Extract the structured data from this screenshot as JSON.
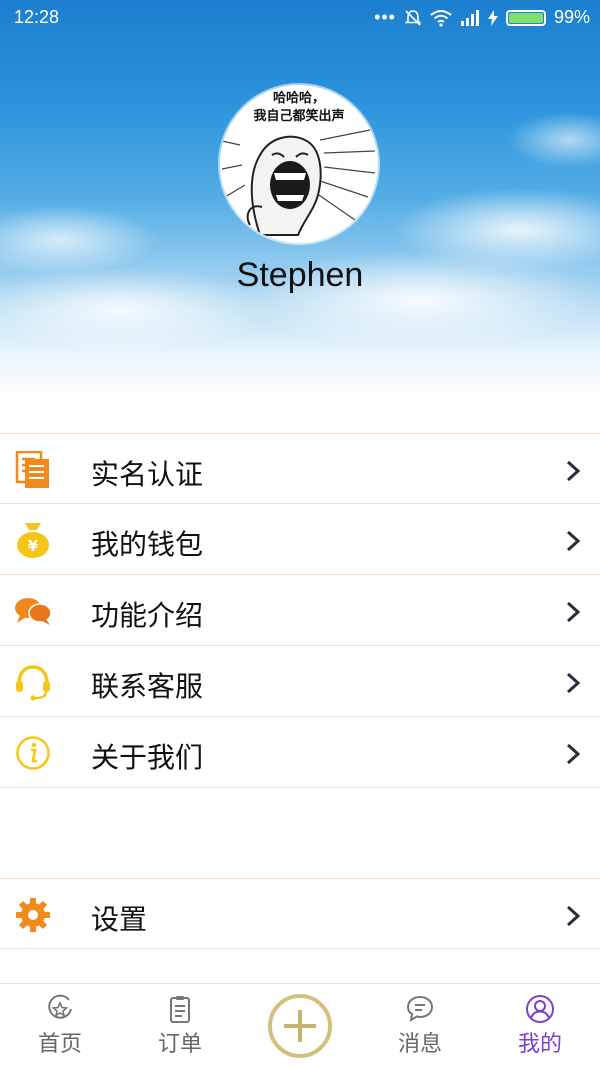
{
  "status_bar": {
    "time": "12:28",
    "battery": "99%",
    "icons": [
      "more-dots-icon",
      "mute-bell-icon",
      "wifi-icon",
      "signal-icon",
      "charging-icon",
      "battery-icon"
    ]
  },
  "profile": {
    "avatar_caption_line1": "哈哈哈，",
    "avatar_caption_line2": "我自己都笑出声",
    "username": "Stephen"
  },
  "menu": {
    "items": [
      {
        "label": "实名认证",
        "icon": "document-icon"
      },
      {
        "label": "我的钱包",
        "icon": "money-bag-icon"
      },
      {
        "label": "功能介绍",
        "icon": "chat-bubbles-icon"
      },
      {
        "label": "联系客服",
        "icon": "headset-icon"
      },
      {
        "label": "关于我们",
        "icon": "info-icon"
      }
    ],
    "settings": {
      "label": "设置",
      "icon": "gear-icon"
    }
  },
  "tabbar": {
    "tabs": [
      {
        "label": "首页",
        "icon": "home-star-icon"
      },
      {
        "label": "订单",
        "icon": "clipboard-icon"
      },
      {
        "label": "",
        "icon": "plus-circle-icon"
      },
      {
        "label": "消息",
        "icon": "message-icon"
      },
      {
        "label": "我的",
        "icon": "user-icon"
      }
    ],
    "active_index": 4
  },
  "colors": {
    "accent_purple": "#7b3fd6",
    "icon_orange": "#f08a1c",
    "icon_yellow": "#f5c518",
    "divider": "#f8dcc6",
    "add_ring": "#d2c07e"
  }
}
